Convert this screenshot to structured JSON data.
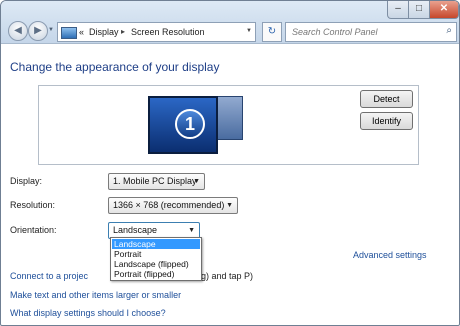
{
  "window": {
    "controls": {
      "minimize": "–",
      "maximize": "□",
      "close": "✕"
    }
  },
  "nav": {
    "back_icon": "back-arrow-icon",
    "forward_icon": "forward-arrow-icon",
    "back_glyph": "◀",
    "forward_glyph": "▶"
  },
  "address": {
    "prefix": "«",
    "crumbs": [
      "Display",
      "Screen Resolution"
    ],
    "separator": "▸"
  },
  "search": {
    "placeholder": "Search Control Panel"
  },
  "main": {
    "heading": "Change the appearance of your display",
    "preview": {
      "monitor_number": "1"
    },
    "detect_label": "Detect",
    "identify_label": "Identify",
    "display_label": "Display:",
    "display_value": "1. Mobile PC Display",
    "resolution_label": "Resolution:",
    "resolution_value": "1366 × 768 (recommended)",
    "orientation_label": "Orientation:",
    "orientation_value": "Landscape",
    "orientation_options": [
      "Landscape",
      "Portrait",
      "Landscape (flipped)",
      "Portrait (flipped)"
    ],
    "advanced_link": "Advanced settings",
    "links": {
      "projector_visible": "Connect to a projec",
      "projector_tail": "g) and tap P)",
      "text_size": "Make text and other items larger or smaller",
      "help": "What display settings should I choose?"
    }
  },
  "colors": {
    "link": "#1e4f9a",
    "heading": "#1f3f87",
    "selection": "#3399ff"
  }
}
